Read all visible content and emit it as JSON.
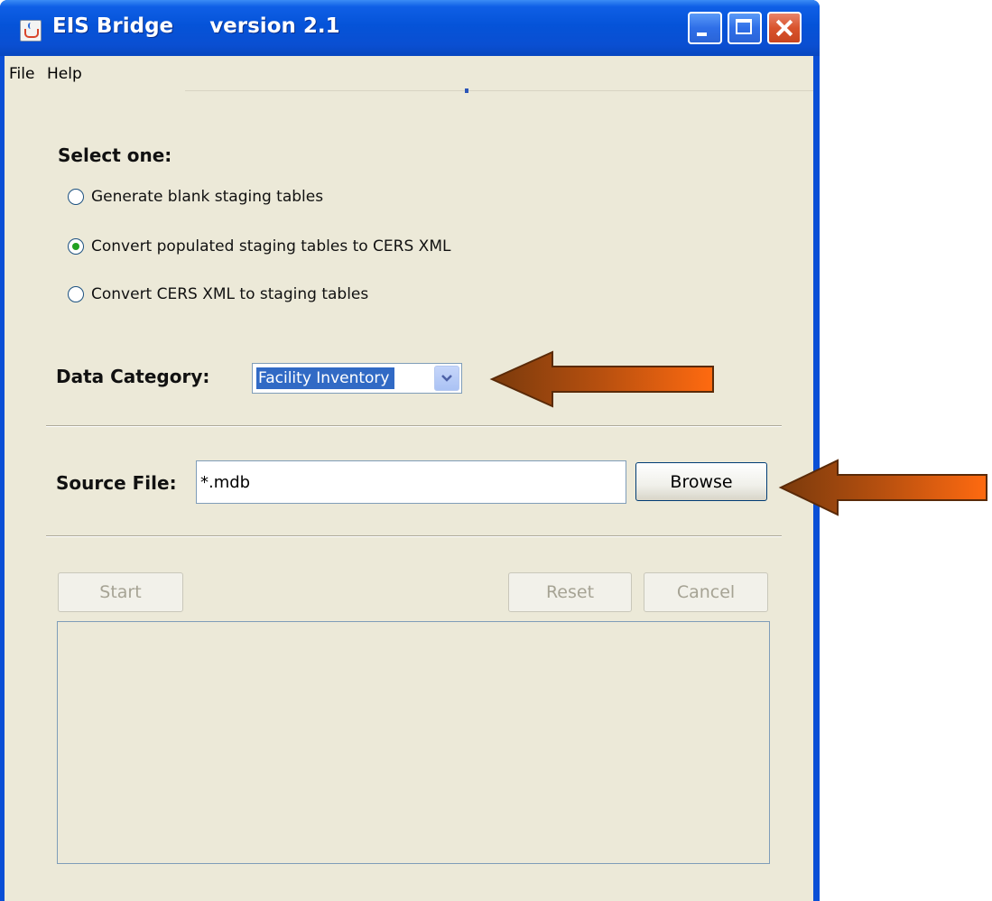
{
  "window": {
    "app_name": "EIS Bridge",
    "version": "version 2.1",
    "title_sep": "     "
  },
  "menu": {
    "items": [
      {
        "label": "File"
      },
      {
        "label": "Help"
      }
    ]
  },
  "selection": {
    "heading": "Select one:",
    "options": [
      {
        "label": "Generate blank staging tables",
        "selected": false
      },
      {
        "label": "Convert populated staging tables to CERS XML",
        "selected": true
      },
      {
        "label": "Convert CERS XML to staging tables",
        "selected": false
      }
    ]
  },
  "data_category": {
    "label": "Data Category:",
    "value": "Facility Inventory"
  },
  "source_file": {
    "label": "Source File:",
    "value": "*.mdb",
    "browse_label": "Browse"
  },
  "actions": {
    "start_label": "Start",
    "reset_label": "Reset",
    "cancel_label": "Cancel"
  },
  "colors": {
    "title_bar": "#0553d8",
    "client_bg": "#ece9d8",
    "selection_highlight": "#316ac5",
    "annotation_arrow": "#e06a1c"
  }
}
